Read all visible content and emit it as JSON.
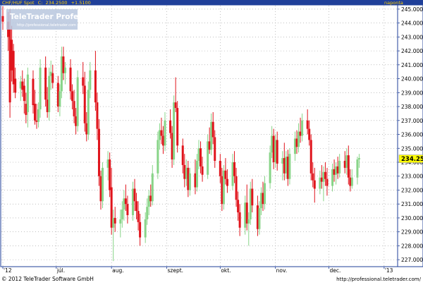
{
  "header": {
    "symbol": "CHF/HUF Spot",
    "close_label": "C:",
    "close_value": "234.2500",
    "change": "+1.5100",
    "period": "naponta"
  },
  "watermark": {
    "brand": "TeleTrader Professional",
    "url": "http://professional.teletrader.com"
  },
  "footer": {
    "copyright": "© 2012 TeleTrader Software GmbH",
    "url": "http://professional.teletrader.com/"
  },
  "colors": {
    "header_bg": "#1f3f99",
    "header_text": "#ffd000",
    "up_candle": "#88d488",
    "down_candle": "#e0141c",
    "last_price_bg": "#ffff00",
    "grid": "#9a9a9a"
  },
  "chart_data": {
    "type": "candlestick",
    "title": "CHF/HUF Spot",
    "ylim": [
      226.5,
      245.3
    ],
    "y_ticks": [
      227,
      228,
      229,
      230,
      231,
      232,
      233,
      234,
      235,
      236,
      237,
      238,
      239,
      240,
      241,
      242,
      243,
      244,
      245
    ],
    "y_tick_labels": [
      "227.0000",
      "228.0000",
      "229.0000",
      "230.0000",
      "231.0000",
      "232.0000",
      "233.0000",
      "234.0000",
      "235.0000",
      "236.0000",
      "237.0000",
      "238.0000",
      "239.0000",
      "240.0000",
      "241.0000",
      "242.0000",
      "243.0000",
      "244.0000",
      "245.0000"
    ],
    "last_price": "234.2500",
    "x_tick_labels": [
      "'12",
      "júl.",
      "aug.",
      "szept.",
      "okt.",
      "nov.",
      "dec.",
      "'13"
    ],
    "x_tick_dates": [
      "2012-06-01",
      "2012-07-01",
      "2012-08-01",
      "2012-09-01",
      "2012-10-01",
      "2012-11-01",
      "2012-12-01",
      "2013-01-01"
    ],
    "x_range": [
      "2012-06-01",
      "2013-01-07"
    ],
    "grid": true,
    "candles": [
      {
        "date": "2012-06-01",
        "o": 244.5,
        "h": 245.2,
        "l": 243.5,
        "c": 244.1
      },
      {
        "date": "2012-06-04",
        "o": 244.1,
        "h": 244.8,
        "l": 242.0,
        "c": 243.0
      },
      {
        "date": "2012-06-05",
        "o": 243.6,
        "h": 245.0,
        "l": 237.2,
        "c": 238.3
      },
      {
        "date": "2012-06-06",
        "o": 242.8,
        "h": 243.8,
        "l": 239.8,
        "c": 240.6
      },
      {
        "date": "2012-06-07",
        "o": 242.0,
        "h": 242.5,
        "l": 239.0,
        "c": 239.6
      },
      {
        "date": "2012-06-08",
        "o": 240.0,
        "h": 240.8,
        "l": 238.6,
        "c": 239.0
      },
      {
        "date": "2012-06-11",
        "o": 239.3,
        "h": 240.2,
        "l": 238.4,
        "c": 239.8
      },
      {
        "date": "2012-06-12",
        "o": 239.8,
        "h": 240.6,
        "l": 238.7,
        "c": 239.2
      },
      {
        "date": "2012-06-13",
        "o": 239.5,
        "h": 240.0,
        "l": 237.5,
        "c": 238.4
      },
      {
        "date": "2012-06-14",
        "o": 238.2,
        "h": 239.0,
        "l": 236.8,
        "c": 237.4
      },
      {
        "date": "2012-06-15",
        "o": 237.6,
        "h": 240.8,
        "l": 236.5,
        "c": 240.3
      },
      {
        "date": "2012-06-18",
        "o": 240.0,
        "h": 240.6,
        "l": 237.5,
        "c": 238.1
      },
      {
        "date": "2012-06-19",
        "o": 238.2,
        "h": 239.2,
        "l": 236.7,
        "c": 237.0
      },
      {
        "date": "2012-06-20",
        "o": 237.0,
        "h": 238.2,
        "l": 236.4,
        "c": 236.9
      },
      {
        "date": "2012-06-21",
        "o": 236.9,
        "h": 238.3,
        "l": 236.5,
        "c": 237.8
      },
      {
        "date": "2012-06-22",
        "o": 237.8,
        "h": 241.4,
        "l": 237.2,
        "c": 240.8
      },
      {
        "date": "2012-06-25",
        "o": 240.8,
        "h": 241.6,
        "l": 238.0,
        "c": 238.5
      },
      {
        "date": "2012-06-26",
        "o": 238.5,
        "h": 239.4,
        "l": 237.2,
        "c": 237.6
      },
      {
        "date": "2012-06-27",
        "o": 237.6,
        "h": 240.8,
        "l": 237.0,
        "c": 240.2
      },
      {
        "date": "2012-06-28",
        "o": 240.2,
        "h": 241.3,
        "l": 239.2,
        "c": 240.5
      },
      {
        "date": "2012-06-29",
        "o": 240.4,
        "h": 241.0,
        "l": 239.3,
        "c": 239.7
      },
      {
        "date": "2012-07-02",
        "o": 239.7,
        "h": 240.2,
        "l": 237.6,
        "c": 238.0
      },
      {
        "date": "2012-07-03",
        "o": 238.0,
        "h": 239.6,
        "l": 237.3,
        "c": 239.1
      },
      {
        "date": "2012-07-04",
        "o": 239.1,
        "h": 242.3,
        "l": 238.6,
        "c": 241.6
      },
      {
        "date": "2012-07-05",
        "o": 241.6,
        "h": 242.3,
        "l": 239.9,
        "c": 240.4
      },
      {
        "date": "2012-07-06",
        "o": 240.4,
        "h": 241.2,
        "l": 239.6,
        "c": 240.8
      },
      {
        "date": "2012-07-09",
        "o": 240.8,
        "h": 241.4,
        "l": 238.5,
        "c": 239.1
      },
      {
        "date": "2012-07-10",
        "o": 239.1,
        "h": 239.6,
        "l": 237.8,
        "c": 238.4
      },
      {
        "date": "2012-07-11",
        "o": 238.4,
        "h": 239.2,
        "l": 236.8,
        "c": 237.3
      },
      {
        "date": "2012-07-12",
        "o": 237.3,
        "h": 237.9,
        "l": 236.0,
        "c": 236.6
      },
      {
        "date": "2012-07-13",
        "o": 236.6,
        "h": 240.6,
        "l": 236.2,
        "c": 240.1
      },
      {
        "date": "2012-07-16",
        "o": 240.1,
        "h": 241.2,
        "l": 238.9,
        "c": 239.5
      },
      {
        "date": "2012-07-17",
        "o": 239.5,
        "h": 240.5,
        "l": 236.2,
        "c": 236.8
      },
      {
        "date": "2012-07-18",
        "o": 236.8,
        "h": 237.6,
        "l": 235.5,
        "c": 236.0
      },
      {
        "date": "2012-07-19",
        "o": 236.0,
        "h": 239.8,
        "l": 235.6,
        "c": 239.2
      },
      {
        "date": "2012-07-20",
        "o": 239.2,
        "h": 241.2,
        "l": 238.6,
        "c": 240.6
      },
      {
        "date": "2012-07-23",
        "o": 240.6,
        "h": 242.0,
        "l": 237.7,
        "c": 238.3
      },
      {
        "date": "2012-07-24",
        "o": 238.3,
        "h": 239.0,
        "l": 235.6,
        "c": 236.4
      },
      {
        "date": "2012-07-25",
        "o": 236.4,
        "h": 237.1,
        "l": 232.3,
        "c": 233.0
      },
      {
        "date": "2012-07-26",
        "o": 233.0,
        "h": 233.4,
        "l": 230.6,
        "c": 231.2
      },
      {
        "date": "2012-07-27",
        "o": 231.2,
        "h": 234.0,
        "l": 230.7,
        "c": 233.6
      },
      {
        "date": "2012-07-30",
        "o": 233.6,
        "h": 234.8,
        "l": 232.7,
        "c": 234.2
      },
      {
        "date": "2012-07-31",
        "o": 234.2,
        "h": 234.7,
        "l": 231.5,
        "c": 232.0
      },
      {
        "date": "2012-08-01",
        "o": 232.2,
        "h": 233.6,
        "l": 228.8,
        "c": 229.3
      },
      {
        "date": "2012-08-02",
        "o": 229.3,
        "h": 230.6,
        "l": 226.9,
        "c": 230.0
      },
      {
        "date": "2012-08-03",
        "o": 230.0,
        "h": 230.8,
        "l": 229.0,
        "c": 229.6
      },
      {
        "date": "2012-08-06",
        "o": 229.6,
        "h": 230.6,
        "l": 228.6,
        "c": 229.9
      },
      {
        "date": "2012-08-07",
        "o": 229.9,
        "h": 231.2,
        "l": 229.3,
        "c": 230.6
      },
      {
        "date": "2012-08-08",
        "o": 230.6,
        "h": 232.0,
        "l": 229.8,
        "c": 231.4
      },
      {
        "date": "2012-08-09",
        "o": 231.4,
        "h": 232.4,
        "l": 230.5,
        "c": 231.0
      },
      {
        "date": "2012-08-10",
        "o": 231.0,
        "h": 231.6,
        "l": 229.6,
        "c": 230.2
      },
      {
        "date": "2012-08-13",
        "o": 230.2,
        "h": 232.6,
        "l": 229.8,
        "c": 232.1
      },
      {
        "date": "2012-08-14",
        "o": 232.1,
        "h": 232.8,
        "l": 230.5,
        "c": 231.2
      },
      {
        "date": "2012-08-15",
        "o": 231.2,
        "h": 231.8,
        "l": 229.9,
        "c": 230.5
      },
      {
        "date": "2012-08-16",
        "o": 230.5,
        "h": 231.2,
        "l": 229.1,
        "c": 229.7
      },
      {
        "date": "2012-08-17",
        "o": 229.7,
        "h": 230.3,
        "l": 228.0,
        "c": 228.6
      },
      {
        "date": "2012-08-20",
        "o": 228.6,
        "h": 230.4,
        "l": 228.2,
        "c": 229.9
      },
      {
        "date": "2012-08-21",
        "o": 229.9,
        "h": 231.4,
        "l": 229.5,
        "c": 230.8
      },
      {
        "date": "2012-08-22",
        "o": 230.8,
        "h": 232.0,
        "l": 230.2,
        "c": 231.6
      },
      {
        "date": "2012-08-23",
        "o": 231.6,
        "h": 232.4,
        "l": 230.8,
        "c": 231.2
      },
      {
        "date": "2012-08-24",
        "o": 231.2,
        "h": 233.8,
        "l": 230.9,
        "c": 233.2
      },
      {
        "date": "2012-08-27",
        "o": 233.2,
        "h": 236.2,
        "l": 232.8,
        "c": 235.6
      },
      {
        "date": "2012-08-28",
        "o": 235.6,
        "h": 236.8,
        "l": 234.9,
        "c": 236.3
      },
      {
        "date": "2012-08-29",
        "o": 236.3,
        "h": 237.2,
        "l": 235.3,
        "c": 235.9
      },
      {
        "date": "2012-08-30",
        "o": 235.9,
        "h": 236.6,
        "l": 234.6,
        "c": 235.2
      },
      {
        "date": "2012-08-31",
        "o": 235.2,
        "h": 237.6,
        "l": 234.8,
        "c": 237.0
      },
      {
        "date": "2012-09-03",
        "o": 237.0,
        "h": 237.8,
        "l": 235.7,
        "c": 236.1
      },
      {
        "date": "2012-09-04",
        "o": 236.1,
        "h": 236.6,
        "l": 233.6,
        "c": 234.2
      },
      {
        "date": "2012-09-05",
        "o": 234.2,
        "h": 238.8,
        "l": 233.8,
        "c": 238.3
      },
      {
        "date": "2012-09-06",
        "o": 238.3,
        "h": 240.1,
        "l": 237.6,
        "c": 237.9
      },
      {
        "date": "2012-09-07",
        "o": 237.9,
        "h": 238.4,
        "l": 234.7,
        "c": 235.2
      },
      {
        "date": "2012-09-10",
        "o": 235.2,
        "h": 235.7,
        "l": 233.2,
        "c": 233.8
      },
      {
        "date": "2012-09-11",
        "o": 233.8,
        "h": 234.6,
        "l": 232.2,
        "c": 232.8
      },
      {
        "date": "2012-09-12",
        "o": 232.8,
        "h": 234.2,
        "l": 232.3,
        "c": 233.6
      },
      {
        "date": "2012-09-13",
        "o": 233.6,
        "h": 234.1,
        "l": 231.5,
        "c": 232.0
      },
      {
        "date": "2012-09-14",
        "o": 232.0,
        "h": 233.6,
        "l": 231.6,
        "c": 233.2
      },
      {
        "date": "2012-09-17",
        "o": 233.2,
        "h": 234.2,
        "l": 231.7,
        "c": 232.2
      },
      {
        "date": "2012-09-18",
        "o": 232.2,
        "h": 234.6,
        "l": 231.9,
        "c": 234.1
      },
      {
        "date": "2012-09-19",
        "o": 234.1,
        "h": 235.6,
        "l": 233.5,
        "c": 235.0
      },
      {
        "date": "2012-09-20",
        "o": 235.0,
        "h": 235.5,
        "l": 233.2,
        "c": 233.7
      },
      {
        "date": "2012-09-21",
        "o": 233.7,
        "h": 234.4,
        "l": 232.6,
        "c": 233.1
      },
      {
        "date": "2012-09-24",
        "o": 233.1,
        "h": 236.0,
        "l": 232.8,
        "c": 235.5
      },
      {
        "date": "2012-09-25",
        "o": 235.5,
        "h": 236.5,
        "l": 234.6,
        "c": 234.9
      },
      {
        "date": "2012-09-26",
        "o": 234.9,
        "h": 237.5,
        "l": 234.5,
        "c": 236.9
      },
      {
        "date": "2012-09-27",
        "o": 236.9,
        "h": 237.6,
        "l": 235.3,
        "c": 235.8
      },
      {
        "date": "2012-09-28",
        "o": 235.8,
        "h": 236.3,
        "l": 233.6,
        "c": 234.1
      },
      {
        "date": "2012-10-01",
        "o": 234.1,
        "h": 234.6,
        "l": 232.5,
        "c": 233.0
      },
      {
        "date": "2012-10-02",
        "o": 233.0,
        "h": 233.6,
        "l": 230.5,
        "c": 231.0
      },
      {
        "date": "2012-10-03",
        "o": 231.0,
        "h": 233.8,
        "l": 230.6,
        "c": 233.4
      },
      {
        "date": "2012-10-04",
        "o": 233.4,
        "h": 234.3,
        "l": 232.4,
        "c": 232.8
      },
      {
        "date": "2012-10-05",
        "o": 232.8,
        "h": 233.5,
        "l": 231.8,
        "c": 232.3
      },
      {
        "date": "2012-10-08",
        "o": 232.3,
        "h": 234.6,
        "l": 232.0,
        "c": 234.0
      },
      {
        "date": "2012-10-09",
        "o": 234.0,
        "h": 234.8,
        "l": 232.5,
        "c": 233.0
      },
      {
        "date": "2012-10-10",
        "o": 233.0,
        "h": 233.6,
        "l": 230.8,
        "c": 231.3
      },
      {
        "date": "2012-10-11",
        "o": 231.3,
        "h": 231.9,
        "l": 229.8,
        "c": 230.4
      },
      {
        "date": "2012-10-12",
        "o": 230.4,
        "h": 231.0,
        "l": 228.7,
        "c": 229.3
      },
      {
        "date": "2012-10-15",
        "o": 229.3,
        "h": 231.6,
        "l": 228.8,
        "c": 231.1
      },
      {
        "date": "2012-10-16",
        "o": 231.1,
        "h": 232.4,
        "l": 229.1,
        "c": 229.6
      },
      {
        "date": "2012-10-17",
        "o": 229.6,
        "h": 230.4,
        "l": 228.0,
        "c": 229.9
      },
      {
        "date": "2012-10-18",
        "o": 229.9,
        "h": 232.6,
        "l": 229.5,
        "c": 232.1
      },
      {
        "date": "2012-10-19",
        "o": 232.1,
        "h": 232.8,
        "l": 230.4,
        "c": 230.9
      },
      {
        "date": "2012-10-22",
        "o": 230.9,
        "h": 231.6,
        "l": 228.7,
        "c": 229.2
      },
      {
        "date": "2012-10-23",
        "o": 229.2,
        "h": 231.2,
        "l": 228.8,
        "c": 230.7
      },
      {
        "date": "2012-10-24",
        "o": 230.7,
        "h": 232.2,
        "l": 230.2,
        "c": 231.8
      },
      {
        "date": "2012-10-25",
        "o": 231.8,
        "h": 232.6,
        "l": 230.5,
        "c": 231.0
      },
      {
        "date": "2012-10-26",
        "o": 231.0,
        "h": 233.0,
        "l": 230.6,
        "c": 232.5
      },
      {
        "date": "2012-10-29",
        "o": 232.5,
        "h": 235.2,
        "l": 232.1,
        "c": 234.7
      },
      {
        "date": "2012-10-30",
        "o": 234.7,
        "h": 236.6,
        "l": 234.3,
        "c": 235.9
      },
      {
        "date": "2012-10-31",
        "o": 235.9,
        "h": 236.4,
        "l": 233.5,
        "c": 234.0
      },
      {
        "date": "2012-11-01",
        "o": 234.0,
        "h": 236.0,
        "l": 233.6,
        "c": 235.6
      },
      {
        "date": "2012-11-02",
        "o": 235.6,
        "h": 236.2,
        "l": 233.4,
        "c": 233.9
      },
      {
        "date": "2012-11-05",
        "o": 233.9,
        "h": 234.8,
        "l": 232.7,
        "c": 234.3
      },
      {
        "date": "2012-11-06",
        "o": 234.3,
        "h": 235.4,
        "l": 232.7,
        "c": 233.2
      },
      {
        "date": "2012-11-07",
        "o": 233.2,
        "h": 234.8,
        "l": 232.8,
        "c": 234.4
      },
      {
        "date": "2012-11-08",
        "o": 234.4,
        "h": 234.9,
        "l": 232.3,
        "c": 232.8
      },
      {
        "date": "2012-11-09",
        "o": 232.8,
        "h": 235.0,
        "l": 232.4,
        "c": 234.6
      },
      {
        "date": "2012-11-12",
        "o": 234.6,
        "h": 236.2,
        "l": 234.1,
        "c": 235.7
      },
      {
        "date": "2012-11-13",
        "o": 235.7,
        "h": 236.3,
        "l": 234.6,
        "c": 235.1
      },
      {
        "date": "2012-11-14",
        "o": 235.1,
        "h": 236.8,
        "l": 234.7,
        "c": 236.2
      },
      {
        "date": "2012-11-15",
        "o": 236.2,
        "h": 237.2,
        "l": 235.4,
        "c": 235.9
      },
      {
        "date": "2012-11-16",
        "o": 235.9,
        "h": 237.5,
        "l": 235.5,
        "c": 237.0
      },
      {
        "date": "2012-11-19",
        "o": 237.0,
        "h": 237.8,
        "l": 236.0,
        "c": 236.4
      },
      {
        "date": "2012-11-20",
        "o": 236.4,
        "h": 237.0,
        "l": 235.2,
        "c": 235.6
      },
      {
        "date": "2012-11-21",
        "o": 235.6,
        "h": 236.0,
        "l": 232.7,
        "c": 233.2
      },
      {
        "date": "2012-11-22",
        "o": 233.2,
        "h": 234.0,
        "l": 232.2,
        "c": 232.7
      },
      {
        "date": "2012-11-23",
        "o": 232.7,
        "h": 233.6,
        "l": 231.1,
        "c": 232.1
      },
      {
        "date": "2012-11-26",
        "o": 232.1,
        "h": 233.4,
        "l": 231.7,
        "c": 232.9
      },
      {
        "date": "2012-11-27",
        "o": 232.9,
        "h": 233.8,
        "l": 232.1,
        "c": 232.6
      },
      {
        "date": "2012-11-28",
        "o": 232.6,
        "h": 233.7,
        "l": 231.2,
        "c": 233.3
      },
      {
        "date": "2012-11-29",
        "o": 233.3,
        "h": 234.0,
        "l": 232.3,
        "c": 232.8
      },
      {
        "date": "2012-11-30",
        "o": 232.8,
        "h": 233.6,
        "l": 231.6,
        "c": 232.3
      },
      {
        "date": "2012-12-03",
        "o": 232.3,
        "h": 233.9,
        "l": 231.9,
        "c": 233.5
      },
      {
        "date": "2012-12-04",
        "o": 233.5,
        "h": 234.2,
        "l": 232.6,
        "c": 233.1
      },
      {
        "date": "2012-12-05",
        "o": 233.1,
        "h": 234.0,
        "l": 232.4,
        "c": 233.7
      },
      {
        "date": "2012-12-06",
        "o": 233.7,
        "h": 234.4,
        "l": 232.8,
        "c": 233.2
      },
      {
        "date": "2012-12-07",
        "o": 233.2,
        "h": 234.6,
        "l": 232.9,
        "c": 234.1
      },
      {
        "date": "2012-12-10",
        "o": 234.1,
        "h": 234.8,
        "l": 233.2,
        "c": 233.6
      },
      {
        "date": "2012-12-11",
        "o": 233.6,
        "h": 235.0,
        "l": 233.1,
        "c": 234.5
      },
      {
        "date": "2012-12-12",
        "o": 234.5,
        "h": 235.2,
        "l": 232.4,
        "c": 232.9
      },
      {
        "date": "2012-12-13",
        "o": 232.9,
        "h": 233.5,
        "l": 231.9,
        "c": 232.3
      },
      {
        "date": "2012-12-14",
        "o": 232.3,
        "h": 233.5,
        "l": 232.1,
        "c": 232.9
      },
      {
        "date": "2012-12-17",
        "o": 232.9,
        "h": 234.4,
        "l": 232.4,
        "c": 234.2
      },
      {
        "date": "2012-12-18",
        "o": 234.2,
        "h": 234.6,
        "l": 233.6,
        "c": 234.3
      }
    ]
  }
}
